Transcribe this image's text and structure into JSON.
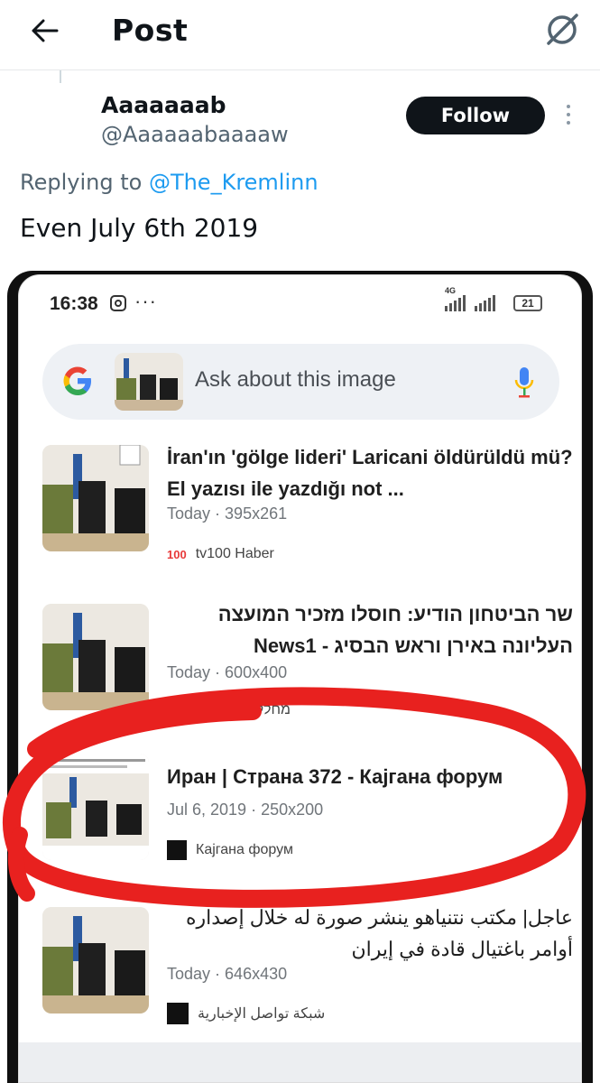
{
  "header": {
    "title": "Post"
  },
  "author": {
    "name": "Aaaaaaab",
    "handle": "@Aaaaaabaaaaw",
    "follow_label": "Follow"
  },
  "reply": {
    "prefix": "Replying to ",
    "mention": "@The_Kremlinn"
  },
  "post": {
    "text": "Even July 6th 2019"
  },
  "phone": {
    "status": {
      "time": "16:38",
      "dots": "···",
      "network": "4G",
      "battery": "21"
    },
    "search": {
      "placeholder": "Ask about this image"
    },
    "results": [
      {
        "title": "İran'ın 'gölge lideri' Laricani öldürüldü mü? El yazısı ile yazdığı not ...",
        "date": "Today",
        "size": "395x261",
        "source": "tv100 Haber",
        "source_badge": "100",
        "rtl": false
      },
      {
        "title": "שר הביטחון הודיע: חוסלו מזכיר המועצה העליונה באירן וראש הבסיג - News1",
        "date": "Today",
        "size": "600x400",
        "source": "מחלקה ראשונה",
        "source_badge": "N1",
        "rtl": true
      },
      {
        "title": "Иран | Страна 372 - Кајгана форум",
        "date": "Jul 6, 2019",
        "size": "250x200",
        "source": "Кајгана форум",
        "source_badge": "",
        "rtl": false
      },
      {
        "title": "عاجل| مكتب نتنياهو ينشر صورة له خلال إصداره أوامر باغتيال قادة في إيران",
        "date": "Today",
        "size": "646x430",
        "source": "شبكة تواصل الإخبارية",
        "source_badge": "",
        "rtl": true
      }
    ]
  },
  "colors": {
    "accent": "#1d9bf0",
    "annotation_circle": "#e8211f",
    "follow_bg": "#0f1419"
  }
}
